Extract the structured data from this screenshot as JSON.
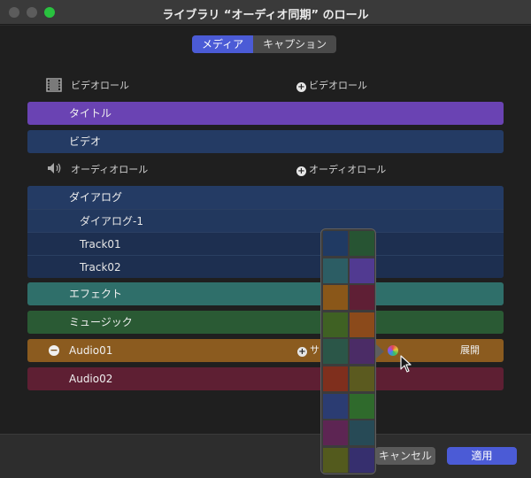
{
  "window": {
    "title": "ライブラリ “オーディオ同期” のロール"
  },
  "tabs": [
    {
      "label": "メディア",
      "active": true
    },
    {
      "label": "キャプション",
      "active": false
    }
  ],
  "video_section": {
    "label": "ビデオロール",
    "add_label": "ビデオロール"
  },
  "video_roles": [
    {
      "label": "タイトル",
      "color": "#6a43b3"
    },
    {
      "label": "ビデオ",
      "color": "#243b64"
    }
  ],
  "audio_section": {
    "label": "オーディオロール",
    "add_label": "オーディオロール"
  },
  "dialog_role": {
    "label": "ダイアログ",
    "color": "#243b64",
    "subroles": [
      "ダイアログ-1",
      "Track01",
      "Track02"
    ]
  },
  "audio_roles": [
    {
      "label": "エフェクト",
      "color": "#2f6f6a"
    },
    {
      "label": "ミュージック",
      "color": "#2a5a34"
    },
    {
      "label": "Audio01",
      "color": "#8b5b1f",
      "add_label": "サ",
      "expand_label": "展開"
    },
    {
      "label": "Audio02",
      "color": "#5e1f33"
    }
  ],
  "color_palette": [
    "#203a63",
    "#275433",
    "#2c5d64",
    "#513a91",
    "#8a5719",
    "#5f1f35",
    "#3f6123",
    "#8b4a1b",
    "#2b5648",
    "#4b2c66",
    "#7f2f1d",
    "#5b5a1f",
    "#2b3c72",
    "#2f6a2c",
    "#5d2553",
    "#274a56",
    "#535a1d",
    "#362f6e"
  ],
  "footer": {
    "cancel_label": "キャンセル",
    "apply_label": "適用"
  }
}
